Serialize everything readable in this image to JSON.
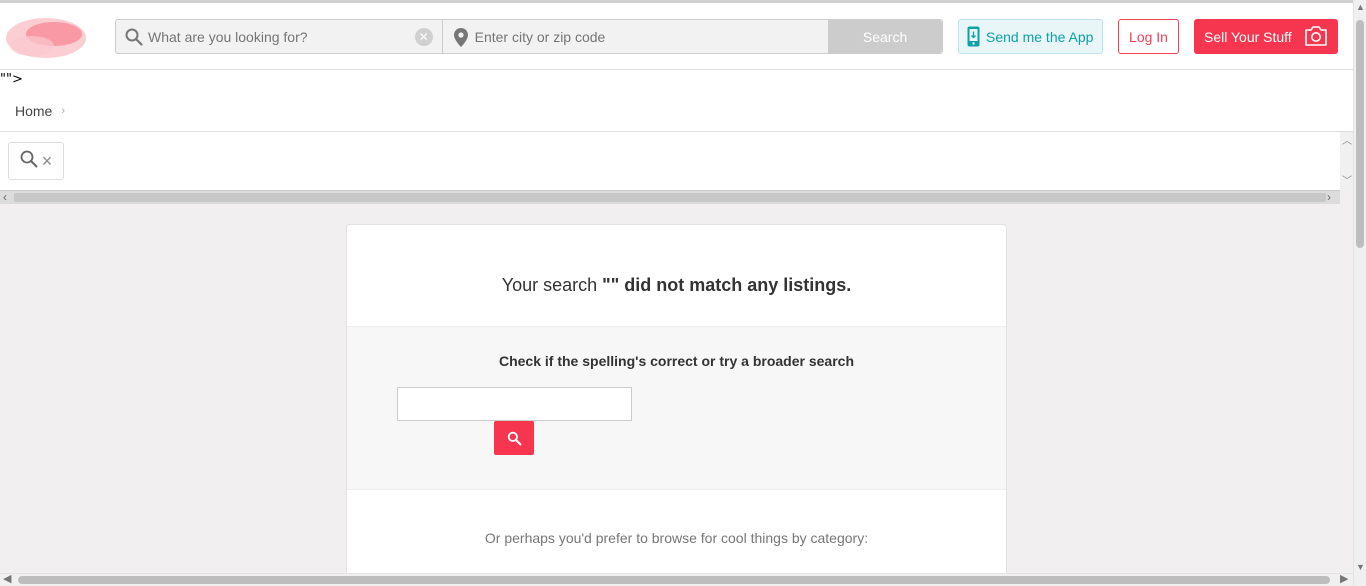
{
  "header": {
    "search_placeholder": "What are you looking for?",
    "location_placeholder": "Enter city or zip code",
    "search_button": "Search",
    "send_app": "Send me the App",
    "login": "Log In",
    "sell": "Sell Your Stuff"
  },
  "stray_text": "\"\">",
  "breadcrumb": {
    "home": "Home",
    "separator": "›"
  },
  "filter": {
    "clear_symbol": "×"
  },
  "results": {
    "no_match_prefix": "Your search ",
    "no_match_query": "\"\" did not match any listings.",
    "suggest_title": "Check if the spelling's correct or try a broader search",
    "suggest_input_value": "",
    "browse_text": "Or perhaps you'd prefer to browse for cool things by category:"
  },
  "colors": {
    "accent": "#f6364f",
    "app_teal": "#0fa0a8",
    "page_bg": "#f1efef"
  }
}
